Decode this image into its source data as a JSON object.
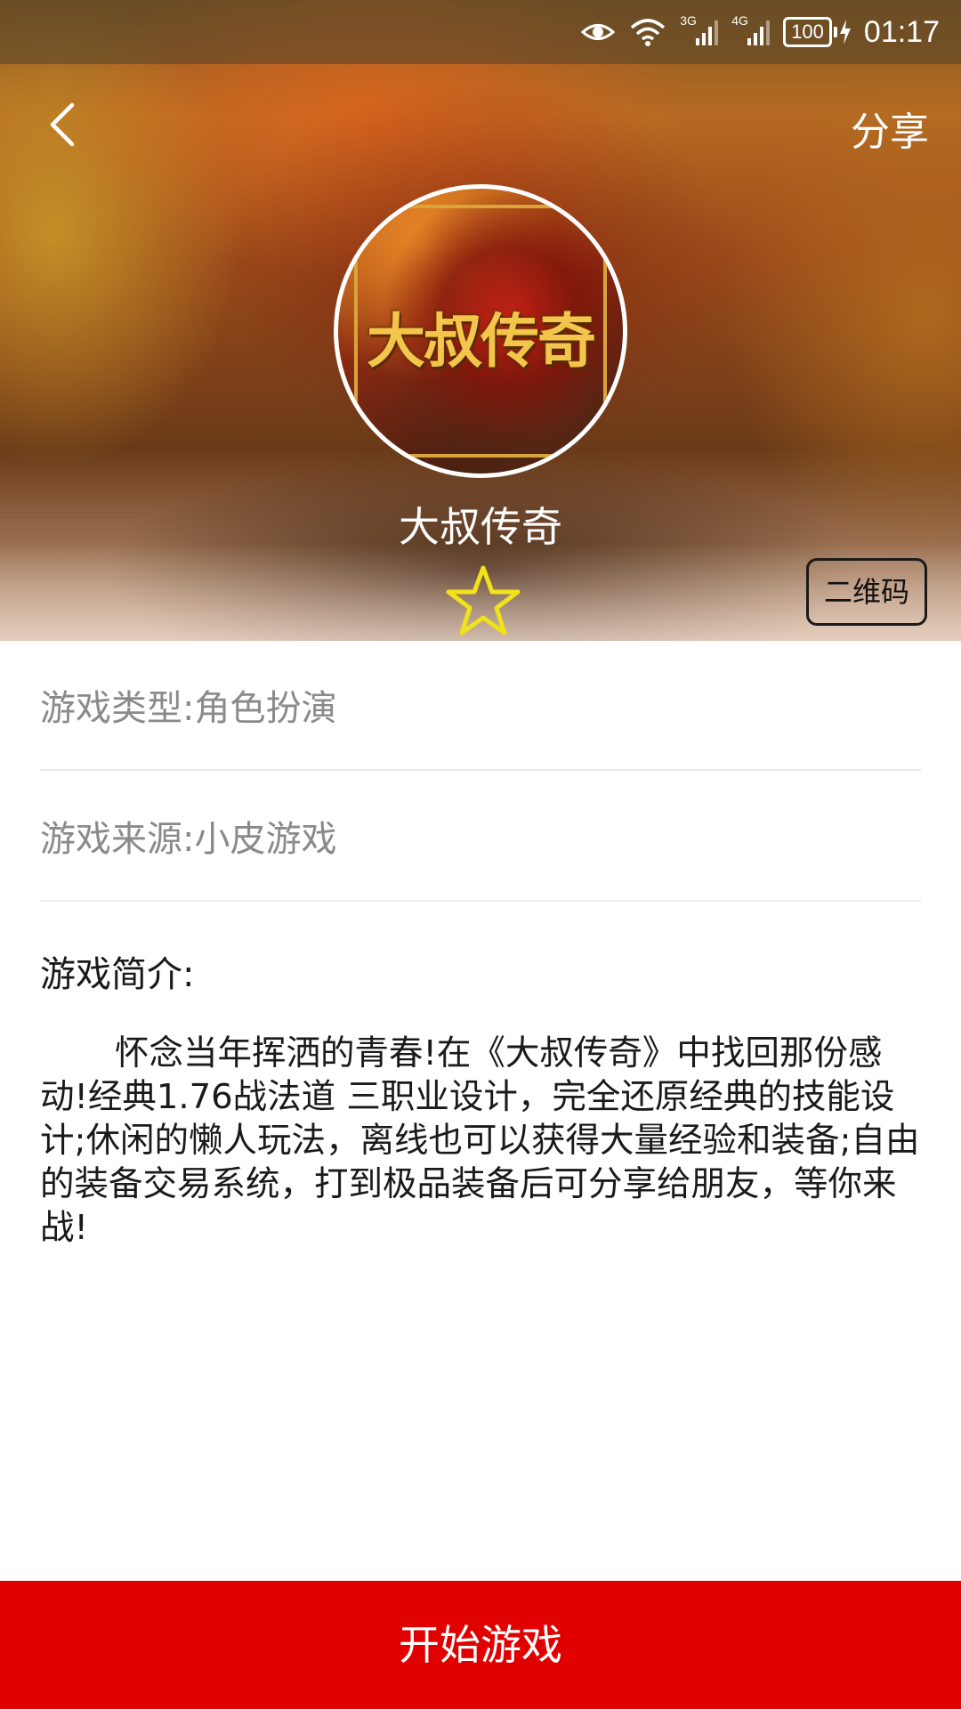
{
  "status_bar": {
    "time": "01:17",
    "battery": "100",
    "network_1": "3G",
    "network_2": "4G",
    "icons": [
      "eye-icon",
      "wifi-icon",
      "signal-3g-icon",
      "signal-4g-icon",
      "battery-icon",
      "charging-icon"
    ]
  },
  "nav": {
    "back_icon": "chevron-left-icon",
    "share_label": "分享"
  },
  "game": {
    "logo_text": "大叔传奇",
    "title": "大叔传奇",
    "favorite_icon": "star-outline-icon",
    "qrcode_label": "二维码",
    "type_line": "游戏类型:角色扮演",
    "source_line": "游戏来源:小皮游戏",
    "intro_heading": "游戏简介:",
    "intro_text": "怀念当年挥洒的青春!在《大叔传奇》中找回那份感动!经典1.76战法道 三职业设计，完全还原经典的技能设计;休闲的懒人玩法，离线也可以获得大量经验和装备;自由的装备交易系统，打到极品装备后可分享给朋友，等你来战!"
  },
  "actions": {
    "start_label": "开始游戏"
  },
  "colors": {
    "primary_red": "#e10000",
    "star_yellow": "#f1e21a",
    "divider": "#ebebeb",
    "muted_text": "#8a8a8a"
  }
}
